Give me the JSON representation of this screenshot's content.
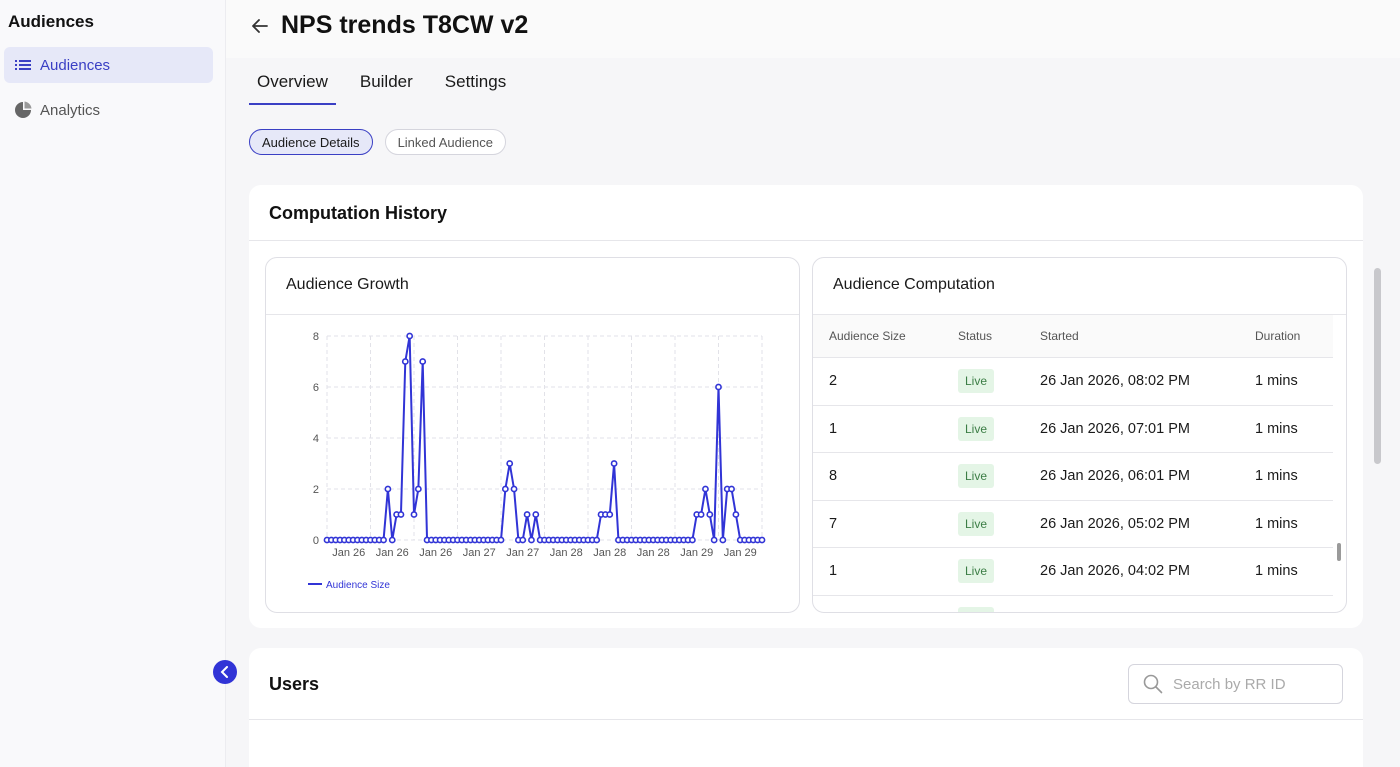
{
  "sidebar": {
    "title": "Audiences",
    "items": [
      {
        "label": "Audiences",
        "icon": "list-icon",
        "active": true
      },
      {
        "label": "Analytics",
        "icon": "pie-chart-icon",
        "active": false
      }
    ]
  },
  "header": {
    "title": "NPS trends T8CW v2"
  },
  "tabs": [
    {
      "label": "Overview",
      "active": true
    },
    {
      "label": "Builder",
      "active": false
    },
    {
      "label": "Settings",
      "active": false
    }
  ],
  "pills": [
    {
      "label": "Audience Details",
      "active": true
    },
    {
      "label": "Linked Audience",
      "active": false
    }
  ],
  "computation_history": {
    "title": "Computation History",
    "growth": {
      "title": "Audience Growth"
    },
    "computation": {
      "title": "Audience Computation",
      "columns": [
        "Audience Size",
        "Status",
        "Started",
        "Duration"
      ],
      "rows": [
        {
          "size": "2",
          "status": "Live",
          "started": "26 Jan 2026, 08:02 PM",
          "duration": "1 mins"
        },
        {
          "size": "1",
          "status": "Live",
          "started": "26 Jan 2026, 07:01 PM",
          "duration": "1 mins"
        },
        {
          "size": "8",
          "status": "Live",
          "started": "26 Jan 2026, 06:01 PM",
          "duration": "1 mins"
        },
        {
          "size": "7",
          "status": "Live",
          "started": "26 Jan 2026, 05:02 PM",
          "duration": "1 mins"
        },
        {
          "size": "1",
          "status": "Live",
          "started": "26 Jan 2026, 04:02 PM",
          "duration": "1 mins"
        },
        {
          "size": "",
          "status": "Live",
          "started": "",
          "duration": ""
        }
      ]
    }
  },
  "users": {
    "title": "Users",
    "search_placeholder": "Search by RR ID"
  },
  "colors": {
    "accent": "#3134d6",
    "live_bg": "#e4f5e6",
    "live_text": "#3b7d45"
  },
  "chart_data": {
    "type": "line",
    "title": "",
    "xlabel": "",
    "ylabel": "",
    "ylim": [
      0,
      8
    ],
    "yticks": [
      0,
      2,
      4,
      6,
      8
    ],
    "xticklabels": [
      "Jan 26",
      "Jan 26",
      "Jan 26",
      "Jan 27",
      "Jan 27",
      "Jan 28",
      "Jan 28",
      "Jan 28",
      "Jan 29",
      "Jan 29"
    ],
    "grid": true,
    "legend": "bottom-left",
    "series": [
      {
        "name": "Audience Size",
        "color": "#3134d6",
        "values": [
          0,
          0,
          0,
          0,
          0,
          0,
          0,
          0,
          0,
          0,
          0,
          0,
          0,
          0,
          2,
          0,
          1,
          1,
          7,
          8,
          1,
          2,
          7,
          0,
          0,
          0,
          0,
          0,
          0,
          0,
          0,
          0,
          0,
          0,
          0,
          0,
          0,
          0,
          0,
          0,
          0,
          2,
          3,
          2,
          0,
          0,
          1,
          0,
          1,
          0,
          0,
          0,
          0,
          0,
          0,
          0,
          0,
          0,
          0,
          0,
          0,
          0,
          0,
          1,
          1,
          1,
          3,
          0,
          0,
          0,
          0,
          0,
          0,
          0,
          0,
          0,
          0,
          0,
          0,
          0,
          0,
          0,
          0,
          0,
          0,
          1,
          1,
          2,
          1,
          0,
          6,
          0,
          2,
          2,
          1,
          0,
          0,
          0,
          0,
          0,
          0
        ]
      }
    ]
  }
}
